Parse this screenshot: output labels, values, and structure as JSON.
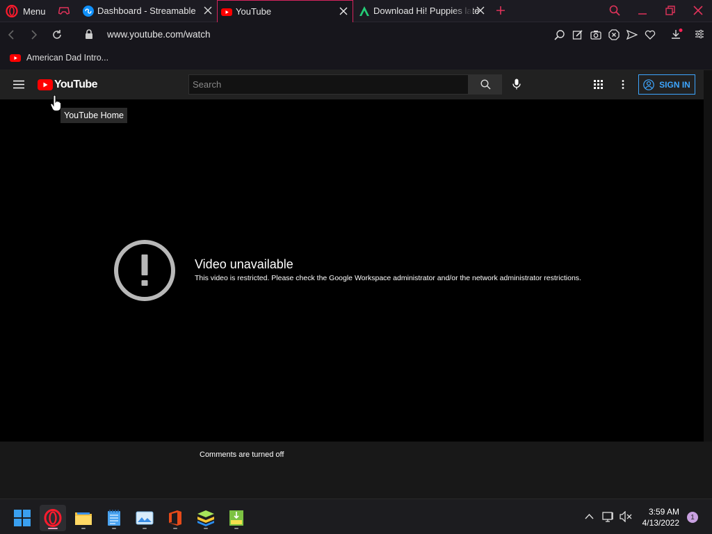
{
  "browser": {
    "menu_label": "Menu",
    "tabs": [
      {
        "title": "Dashboard - Streamable",
        "icon": "streamable-icon"
      },
      {
        "title": "YouTube",
        "icon": "youtube-icon",
        "active": true
      },
      {
        "title": "Download Hi! Puppies late",
        "icon": "apkpure-icon"
      }
    ],
    "url": "www.youtube.com/watch",
    "bookmarks": [
      {
        "label": "American Dad Intro...",
        "icon": "youtube-icon"
      }
    ],
    "accent_color": "#d6245d"
  },
  "youtube": {
    "logo_text": "YouTube",
    "search_placeholder": "Search",
    "signin_label": "SIGN IN",
    "tooltip": "YouTube Home",
    "error_title": "Video unavailable",
    "error_message": "This video is restricted. Please check the Google Workspace administrator and/or the network administrator restrictions.",
    "comments_status": "Comments are turned off",
    "brand_color": "#ff0000",
    "link_color": "#3ea6ff"
  },
  "taskbar": {
    "apps": [
      "windows-start-icon",
      "opera-icon",
      "file-explorer-icon",
      "notepad-icon",
      "photos-icon",
      "office-icon",
      "bluestacks-icon",
      "archive-icon"
    ],
    "time": "3:59 AM",
    "date": "4/13/2022",
    "notification_count": "1"
  }
}
